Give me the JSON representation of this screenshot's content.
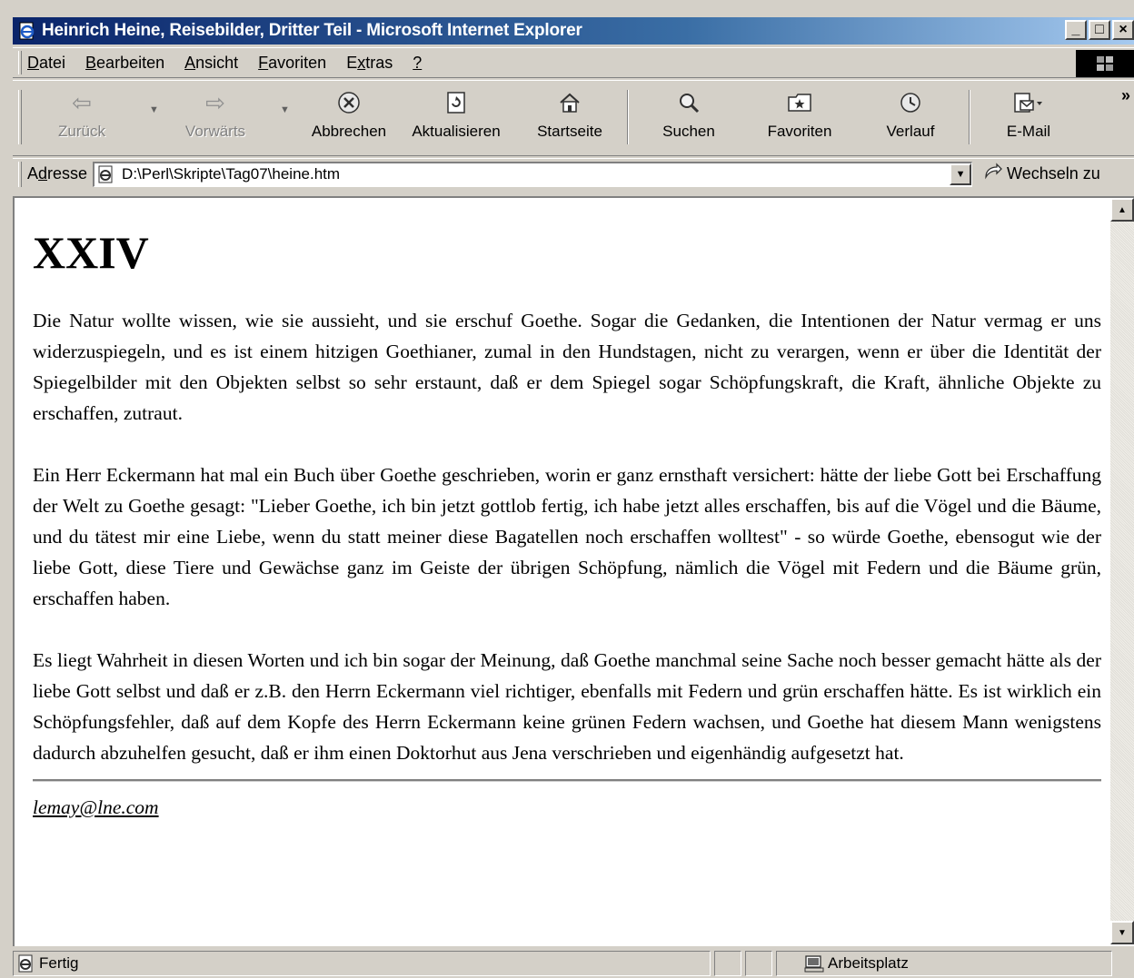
{
  "window": {
    "title": "Heinrich Heine, Reisebilder, Dritter Teil - Microsoft Internet Explorer",
    "controls": {
      "minimize": "_",
      "maximize": "□",
      "close": "×"
    }
  },
  "menu": [
    {
      "label": "Datei",
      "underline": "D",
      "rest": "atei"
    },
    {
      "label": "Bearbeiten",
      "underline": "B",
      "rest": "earbeiten"
    },
    {
      "label": "Ansicht",
      "underline": "A",
      "rest": "nsicht"
    },
    {
      "label": "Favoriten",
      "underline": "F",
      "rest": "avoriten"
    },
    {
      "label": "Extras",
      "pre": "E",
      "underline": "x",
      "rest": "tras"
    },
    {
      "label": "?",
      "underline": "?",
      "rest": ""
    }
  ],
  "toolbar": {
    "back": "Zurück",
    "forward": "Vorwärts",
    "stop": "Abbrechen",
    "refresh": "Aktualisieren",
    "home": "Startseite",
    "search": "Suchen",
    "favorites": "Favoriten",
    "history": "Verlauf",
    "mail": "E-Mail",
    "more": "»"
  },
  "address": {
    "label_pre": "A",
    "label_underline": "d",
    "label_rest": "resse",
    "value": "D:\\Perl\\Skripte\\Tag07\\heine.htm",
    "go_label": "Wechseln zu"
  },
  "content": {
    "heading": "XXIV",
    "paragraphs": [
      "Die Natur wollte wissen, wie sie aussieht, und sie erschuf Goethe. Sogar die Gedanken, die Intentionen der Natur vermag er uns widerzuspiegeln, und es ist einem hitzigen Goethianer, zumal in den Hundstagen, nicht zu verargen, wenn er über die Identität der Spiegelbilder mit den Objekten selbst so sehr erstaunt, daß er dem Spiegel sogar Schöpfungskraft, die Kraft, ähnliche Objekte zu erschaffen, zutraut.",
      "Ein Herr Eckermann hat mal ein Buch über Goethe geschrieben, worin er ganz ernsthaft versichert: hätte der liebe Gott bei Erschaffung der Welt zu Goethe gesagt: \"Lieber Goethe, ich bin jetzt gottlob fertig, ich habe jetzt alles erschaffen, bis auf die Vögel und die Bäume, und du tätest mir eine Liebe, wenn du statt meiner diese Bagatellen noch erschaffen wolltest\" - so würde Goethe, ebensogut wie der liebe Gott, diese Tiere und Gewächse ganz im Geiste der übrigen Schöpfung, nämlich die Vögel mit Federn und die Bäume grün, erschaffen haben.",
      "Es liegt Wahrheit in diesen Worten und ich bin sogar der Meinung, daß Goethe manchmal seine Sache noch besser gemacht hätte als der liebe Gott selbst und daß er z.B. den Herrn Eckermann viel richtiger, ebenfalls mit Federn und grün erschaffen hätte. Es ist wirklich ein Schöpfungsfehler, daß auf dem Kopfe des Herrn Eckermann keine grünen Federn wachsen, und Goethe hat diesem Mann wenigstens dadurch abzuhelfen gesucht, daß er ihm einen Doktorhut aus Jena verschrieben und eigenhändig aufgesetzt hat."
    ],
    "email": "lemay@lne.com"
  },
  "status": {
    "text": "Fertig",
    "zone": "Arbeitsplatz"
  },
  "colors": {
    "title_start": "#0a246a",
    "title_end": "#a6caf0",
    "chrome": "#d4d0c8"
  }
}
